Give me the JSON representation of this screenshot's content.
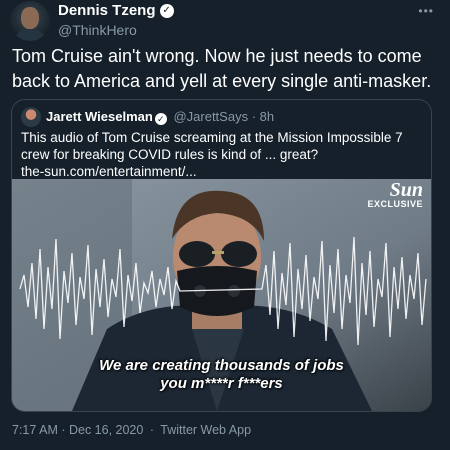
{
  "tweet": {
    "author_name": "Dennis Tzeng",
    "author_handle": "@ThinkHero",
    "text": "Tom Cruise ain't wrong. Now he just needs to come back to America and yell at every single anti-masker.",
    "more_label": "•••",
    "timestamp": "7:17 AM · Dec 16, 2020",
    "separator": "·",
    "source": "Twitter Web App"
  },
  "quoted": {
    "author_name": "Jarett Wieselman",
    "author_handle": "@JarettSays",
    "age": "8h",
    "separator": "·",
    "text": "This audio of Tom Cruise screaming at the Mission Impossible 7 crew for breaking COVID rules is kind of ... great?",
    "link_text": "the-sun.com/entertainment/...",
    "media": {
      "brand": "Sun",
      "brand_sub": "EXCLUSIVE",
      "caption_line1": "We are creating thousands of jobs",
      "caption_line2": "you m****r f***ers"
    }
  },
  "colors": {
    "background": "#15202b",
    "text": "#ffffff",
    "secondary": "#8899a6",
    "border": "#38444d"
  },
  "icons": {
    "verified": "verified-badge-icon",
    "more": "more-horizontal-icon"
  }
}
